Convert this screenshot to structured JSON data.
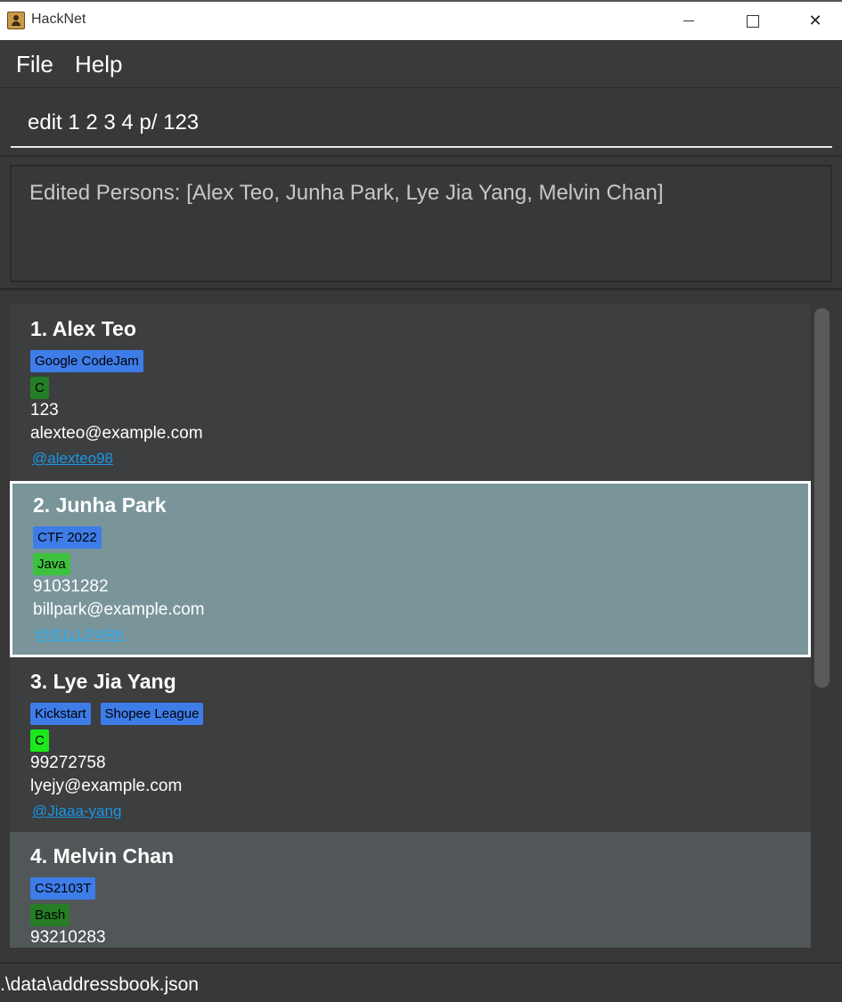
{
  "window": {
    "title": "HackNet",
    "minimize_icon": "minimize-icon",
    "maximize_icon": "maximize-icon",
    "close_icon": "close-icon"
  },
  "menu": {
    "file_label": "File",
    "help_label": "Help"
  },
  "command": {
    "value": "edit 1 2 3 4 p/ 123"
  },
  "result": {
    "text": "Edited Persons: [Alex Teo, Junha Park, Lye Jia Yang, Melvin Chan]"
  },
  "persons": [
    {
      "index_name": "1.  Alex Teo",
      "tags": [
        "Google CodeJam"
      ],
      "langs": [
        "C"
      ],
      "phone": "123",
      "email": "alexteo@example.com",
      "handle": "@alexteo98"
    },
    {
      "index_name": "2.  Junha Park",
      "tags": [
        "CTF 2022"
      ],
      "langs": [
        "Java"
      ],
      "phone": "91031282",
      "email": "billpark@example.com",
      "handle": "@B1LLP4RK",
      "selected": true
    },
    {
      "index_name": "3.  Lye Jia Yang",
      "tags": [
        "Kickstart",
        "Shopee League"
      ],
      "langs": [
        "C"
      ],
      "phone": "99272758",
      "email": "lyejy@example.com",
      "handle": "@Jiaaa-yang"
    },
    {
      "index_name": "4.  Melvin Chan",
      "tags": [
        "CS2103T"
      ],
      "langs": [
        "Bash"
      ],
      "phone": "93210283",
      "email": "",
      "handle": ""
    }
  ],
  "colors": {
    "tag_blue": "#3e7ce8",
    "lang_green_dark": "#257e25",
    "lang_green_mid": "#3ec13e",
    "lang_green_bright": "#1ce61c",
    "selected_card": "#79959a",
    "link": "#1a96e6"
  },
  "status": {
    "path": ".\\data\\addressbook.json"
  }
}
